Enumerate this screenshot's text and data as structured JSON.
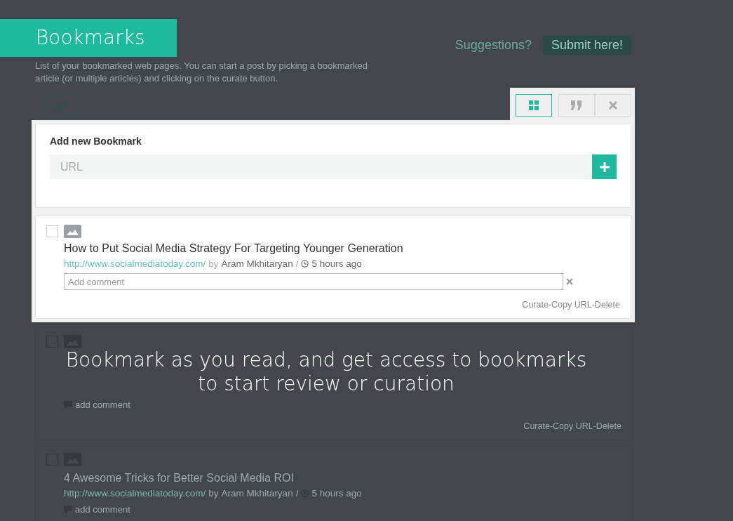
{
  "header": {
    "title": "Bookmarks",
    "suggestion_label": "Suggestions?",
    "submit_button": "Submit here!"
  },
  "description": "List of your bookmarked web pages. You can start a post by picking a bookmarked article (or multiple articles) and clicking on the curate button.",
  "view_buttons": [
    {
      "kind": "grid",
      "selected": true
    },
    {
      "kind": "quote",
      "selected": false
    },
    {
      "kind": "close",
      "selected": false
    }
  ],
  "add_bookmark": {
    "heading": "Add new Bookmark",
    "placeholder": "URL"
  },
  "bookmarks": [
    {
      "highlighted": true,
      "checked": false,
      "title": "How to Put Social Media Strategy For Targeting Younger Generation",
      "url": "http://www.socialmediatoday.com/",
      "by": "by",
      "author": "Aram Mkhitaryan",
      "separator": "/",
      "time": "5 hours ago",
      "comment_placeholder": "Add comment",
      "actions": "Curate-Copy URL-Delete"
    },
    {
      "highlighted": false,
      "checked": false,
      "add_comment": "add comment",
      "actions": "Curate-Copy URL-Delete"
    },
    {
      "highlighted": false,
      "checked": false,
      "title": "4 Awesome Tricks for Better Social Media ROI",
      "url": "http://www.socialmediatoday.com/",
      "by": "by",
      "author": "Aram Mkhitaryan",
      "separator": "/",
      "time": "5 hours ago",
      "add_comment": "add comment"
    }
  ],
  "caption": "Bookmark as you read, and get access to bookmarks to start review or curation"
}
